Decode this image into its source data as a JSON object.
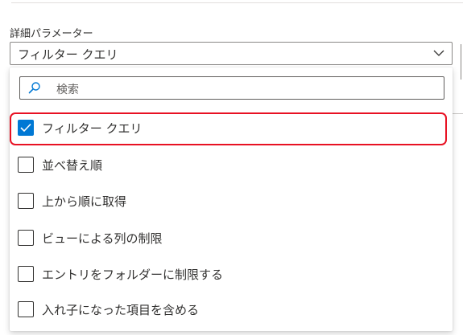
{
  "label": "詳細パラメーター",
  "dropdown": {
    "value": "フィルター クエリ"
  },
  "search": {
    "placeholder": "検索"
  },
  "options": [
    {
      "label": "フィルター クエリ",
      "checked": true
    },
    {
      "label": "並べ替え順",
      "checked": false
    },
    {
      "label": "上から順に取得",
      "checked": false
    },
    {
      "label": "ビューによる列の制限",
      "checked": false
    },
    {
      "label": "エントリをフォルダーに制限する",
      "checked": false
    },
    {
      "label": "入れ子になった項目を含める",
      "checked": false
    }
  ],
  "colors": {
    "accent": "#0078d4",
    "highlight": "#e81123"
  },
  "icons": {
    "search": "search-icon",
    "dropdown": "chevron-down-icon",
    "check": "checkmark-icon"
  }
}
